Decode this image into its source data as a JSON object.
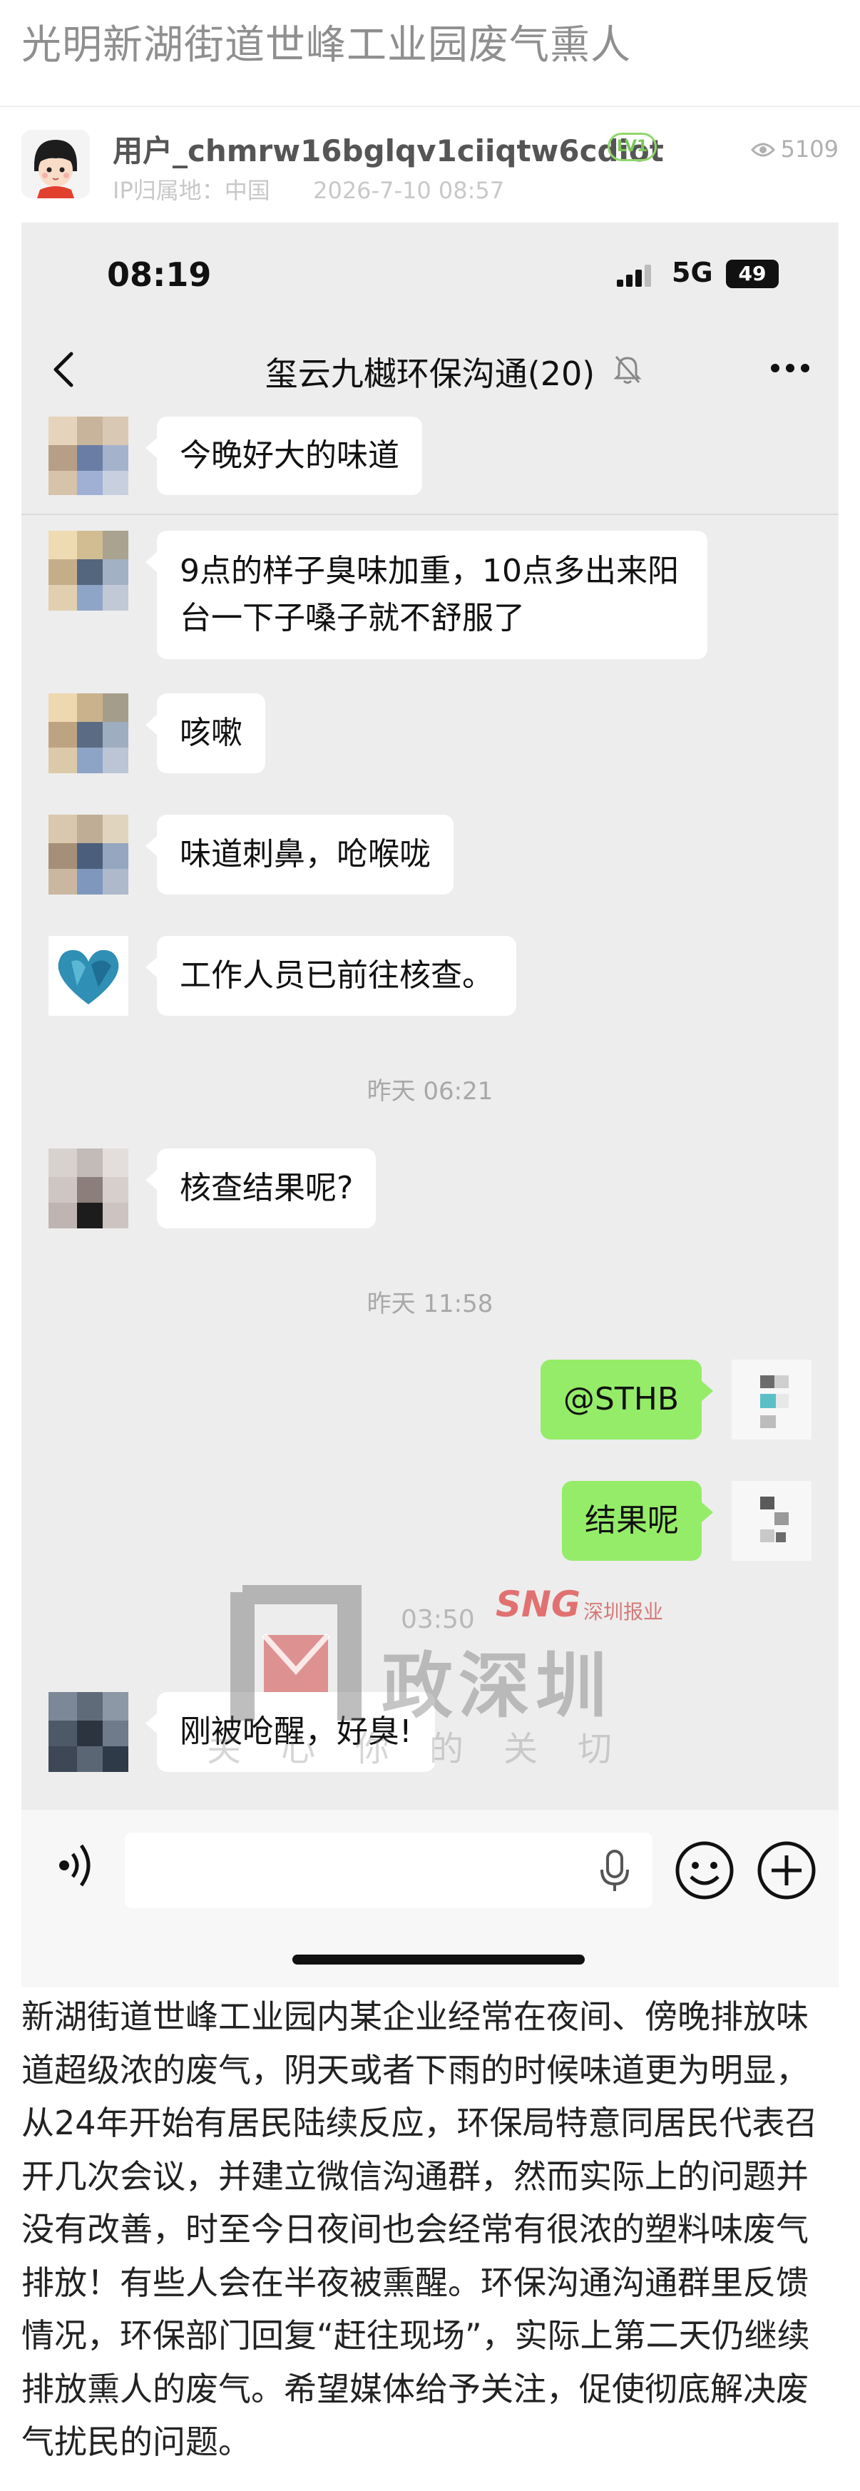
{
  "post": {
    "title": "光明新湖街道世峰工业园废气熏人",
    "username": "用户_chmrw16bglqv1ciiqtw6cdiot",
    "level_badge": "LV1",
    "location": "IP归属地：中国",
    "date": "2026-7-10 08:57",
    "views": "5109",
    "body": "新湖街道世峰工业园内某企业经常在夜间、傍晚排放味道超级浓的废气，阴天或者下雨的时候味道更为明显，从24年开始有居民陆续反应，环保局特意同居民代表召开几次会议，并建立微信沟通群，然而实际上的问题并没有改善，时至今日夜间也会经常有很浓的塑料味废气排放！有些人会在半夜被熏醒。环保沟通沟通群里反馈情况，环保部门回复“赶往现场”，实际上第二天仍继续排放熏人的废气。希望媒体给予关注，促使彻底解决废气扰民的问题。"
  },
  "phone": {
    "time": "08:19",
    "network": "5G",
    "battery": "49",
    "chat_title": "玺云九樾环保沟通(20)",
    "messages": [
      {
        "text": "今晚好大的味道"
      },
      {
        "text": "9点的样子臭味加重，10点多出来阳台一下子嗓子就不舒服了"
      },
      {
        "text": "咳嗽"
      },
      {
        "text": "味道刺鼻，呛喉咙"
      },
      {
        "text": "工作人员已前往核查。"
      },
      {
        "text": "核查结果呢?"
      },
      {
        "text": "@STHB"
      },
      {
        "text": "结果呢"
      },
      {
        "text": "刚被呛醒，好臭!"
      }
    ],
    "timestamps": [
      "昨天 06:21",
      "昨天 11:58",
      "03:50"
    ]
  },
  "watermark": {
    "main": "政深圳",
    "sub": "关心你的关切",
    "brand": "SNG",
    "brand_sub": "深圳报业"
  },
  "colors": {
    "outgoing_bubble": "#95ec69",
    "incoming_bubble": "#ffffff",
    "chat_background": "#ededed",
    "badge": "#8fd66c"
  }
}
